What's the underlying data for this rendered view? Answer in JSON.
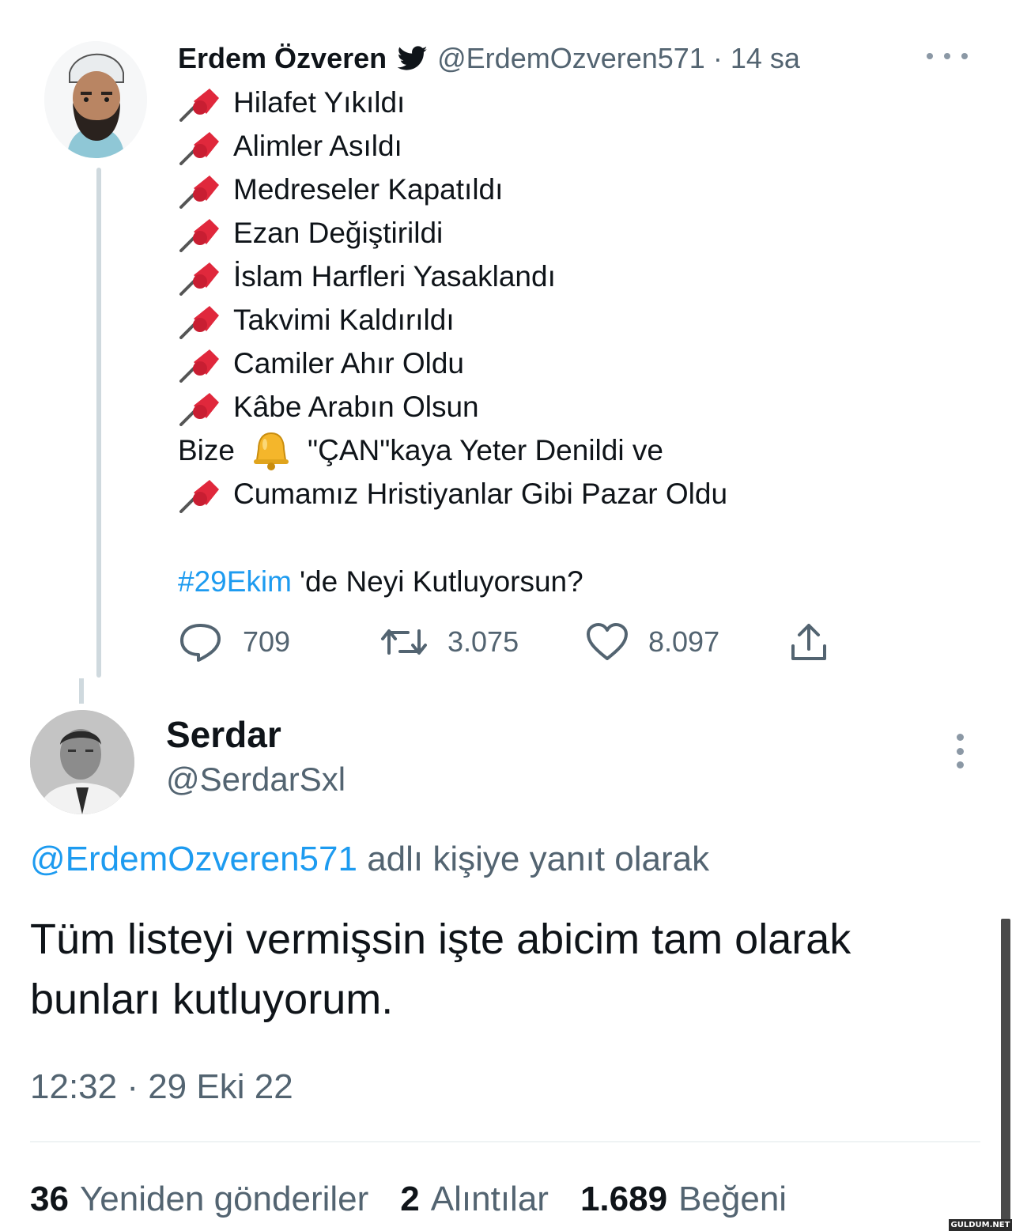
{
  "parent_tweet": {
    "author_name": "Erdem Özveren",
    "handle_time": "@ErdemOzveren571 · 14 sa",
    "lines": [
      {
        "pin": true,
        "text": "Hilafet Yıkıldı"
      },
      {
        "pin": true,
        "text": "Alimler Asıldı"
      },
      {
        "pin": true,
        "text": "Medreseler Kapatıldı"
      },
      {
        "pin": true,
        "text": "Ezan Değiştirildi"
      },
      {
        "pin": true,
        "text": "İslam Harfleri Yasaklandı"
      },
      {
        "pin": true,
        "text": "Takvimi Kaldırıldı"
      },
      {
        "pin": true,
        "text": "Camiler Ahır Oldu"
      },
      {
        "pin": true,
        "text": "Kâbe Arabın Olsun"
      }
    ],
    "bell_line": {
      "before": "Bize",
      "after": "\"ÇAN\"kaya Yeter Denildi ve"
    },
    "last_line": "Cumamız Hristiyanlar Gibi Pazar Oldu",
    "hashtag": "#29Ekim",
    "question": "'de Neyi Kutluyorsun?",
    "replies": "709",
    "retweets": "3.075",
    "likes": "8.097",
    "icons": [
      "twitter-bird-icon",
      "pushpin-icon",
      "bell-icon",
      "reply-icon",
      "retweet-icon",
      "like-icon",
      "share-icon",
      "more-icon"
    ]
  },
  "reply_tweet": {
    "author_name": "Serdar",
    "handle": "@SerdarSxl",
    "replying_mention": "@ErdemOzveren571",
    "replying_suffix": "adlı kişiye yanıt olarak",
    "text": "Tüm listeyi vermişsin işte abicim tam olarak bunları kutluyorum.",
    "timestamp": "12:32 · 29 Eki 22",
    "stats": {
      "retweets_count": "36",
      "retweets_label": "Yeniden gönderiler",
      "quotes_count": "2",
      "quotes_label": "Alıntılar",
      "likes_count": "1.689",
      "likes_label": "Beğeni"
    }
  },
  "watermark": "GULDUM.NET",
  "colors": {
    "link": "#1d9bf0",
    "secondary_text": "#536471",
    "primary_text": "#0f1419",
    "pin_red": "#e0283c"
  }
}
